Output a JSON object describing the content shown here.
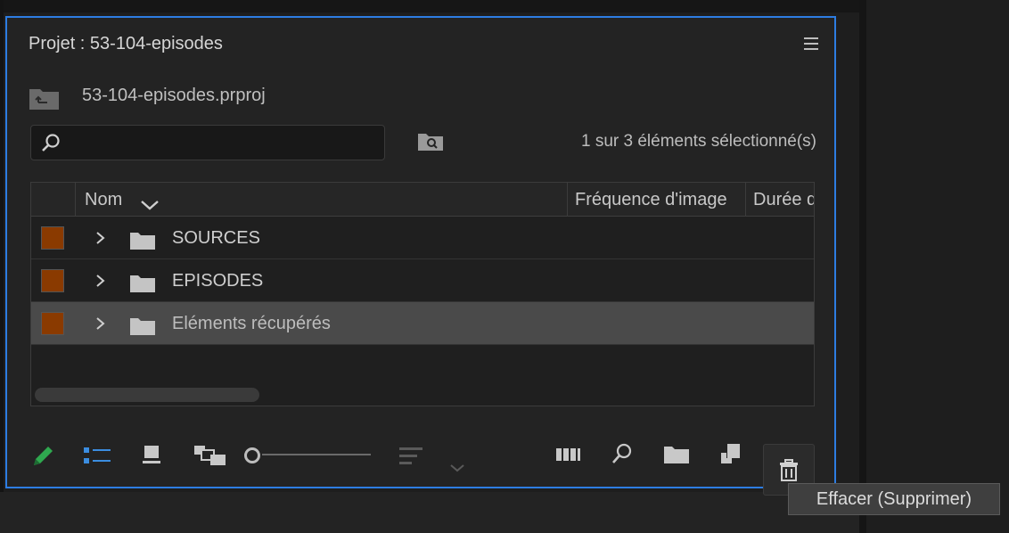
{
  "panel": {
    "title": "Projet : 53-104-episodes",
    "project_file": "53-104-episodes.prproj",
    "search": {
      "value": "",
      "placeholder": ""
    },
    "selection_status": "1 sur 3 éléments sélectionné(s)"
  },
  "table": {
    "columns": {
      "name": "Nom",
      "frame_rate": "Fréquence d'image",
      "duration": "Durée d"
    },
    "rows": [
      {
        "name": "SOURCES",
        "color": "#8a3a00",
        "selected": false
      },
      {
        "name": "EPISODES",
        "color": "#8a3a00",
        "selected": false
      },
      {
        "name": "Eléments récupérés",
        "color": "#8a3a00",
        "selected": true
      }
    ]
  },
  "toolbar": {
    "icons": [
      "pencil-icon",
      "list-view-icon",
      "icon-view-icon",
      "freeform-view-icon",
      "zoom-slider",
      "sort-icon",
      "automate-to-sequence-icon",
      "find-icon",
      "new-bin-icon",
      "new-item-icon",
      "trash-icon"
    ]
  },
  "tooltip": {
    "text": "Effacer (Supprimer)"
  },
  "colors": {
    "accent": "#2d7de2",
    "label_color": "#8a3a00",
    "pencil": "#2fa84f",
    "list_view": "#3b8de0"
  }
}
